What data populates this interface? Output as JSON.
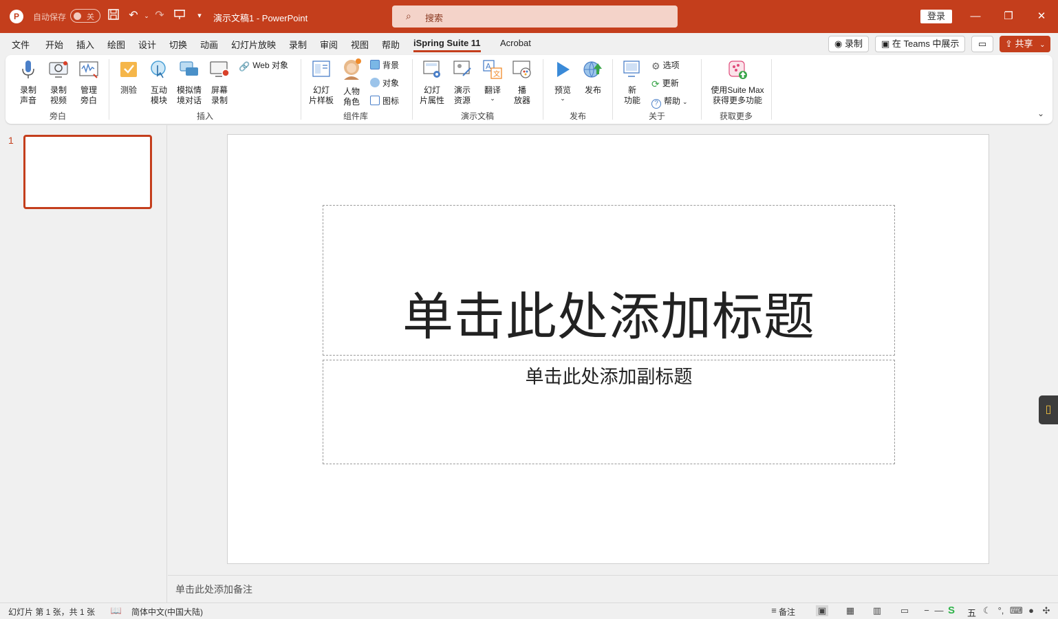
{
  "titlebar": {
    "app_logo": "P",
    "autosave_label": "自动保存",
    "autosave_state": "关",
    "doc_title": "演示文稿1  -  PowerPoint",
    "search_placeholder": "搜索",
    "login_label": "登录",
    "icons": [
      "save-icon",
      "undo-icon",
      "redo-icon",
      "present-icon",
      "customize-icon"
    ]
  },
  "menu": {
    "tabs": [
      "文件",
      "开始",
      "插入",
      "绘图",
      "设计",
      "切换",
      "动画",
      "幻灯片放映",
      "录制",
      "审阅",
      "视图",
      "帮助",
      "iSpring Suite 11",
      "Acrobat"
    ],
    "active_tab": "iSpring Suite 11",
    "record_label": "录制",
    "teams_label": "在 Teams 中展示",
    "share_label": "共享"
  },
  "ribbon": {
    "groups": {
      "narration": "旁白",
      "insert": "插入",
      "library": "组件库",
      "presentation": "演示文稿",
      "publish": "发布",
      "about": "关于",
      "more": "获取更多"
    },
    "narration": {
      "record_audio": [
        "录制",
        "声音"
      ],
      "record_video": [
        "录制",
        "视频"
      ],
      "manage": [
        "管理",
        "旁白"
      ]
    },
    "insert": {
      "quiz": "测验",
      "interaction": [
        "互动",
        "模块"
      ],
      "roleplay": [
        "模拟情",
        "境对话"
      ],
      "screen": [
        "屏幕",
        "录制"
      ],
      "web": "Web 对象"
    },
    "library": {
      "template": [
        "幻灯",
        "片样板"
      ],
      "character": [
        "人物",
        "角色"
      ],
      "background": "背景",
      "object": "对象",
      "icon": "图标"
    },
    "presentation": {
      "properties": [
        "幻灯",
        "片属性"
      ],
      "resources": [
        "演示",
        "资源"
      ],
      "translate": "翻译",
      "player": [
        "播",
        "放器"
      ]
    },
    "publish": {
      "preview": "预览",
      "publish": "发布"
    },
    "about": {
      "new": [
        "新",
        "功能"
      ],
      "options": "选项",
      "update": "更新",
      "help": "帮助"
    },
    "more": {
      "max": [
        "使用Suite Max",
        "获得更多功能"
      ]
    }
  },
  "thumbs": {
    "slide_number": "1"
  },
  "slide": {
    "title_placeholder": "单击此处添加标题",
    "subtitle_placeholder": "单击此处添加副标题"
  },
  "notes": {
    "placeholder": "单击此处添加备注"
  },
  "statusbar": {
    "slide_info": "幻灯片 第 1 张，共 1 张",
    "language": "简体中文(中国大陆)",
    "notes_label": "备注",
    "ime_label": "五"
  },
  "colors": {
    "accent": "#c43e1c",
    "ribbon_bg": "#ffffff",
    "app_bg": "#f0f0f0"
  }
}
